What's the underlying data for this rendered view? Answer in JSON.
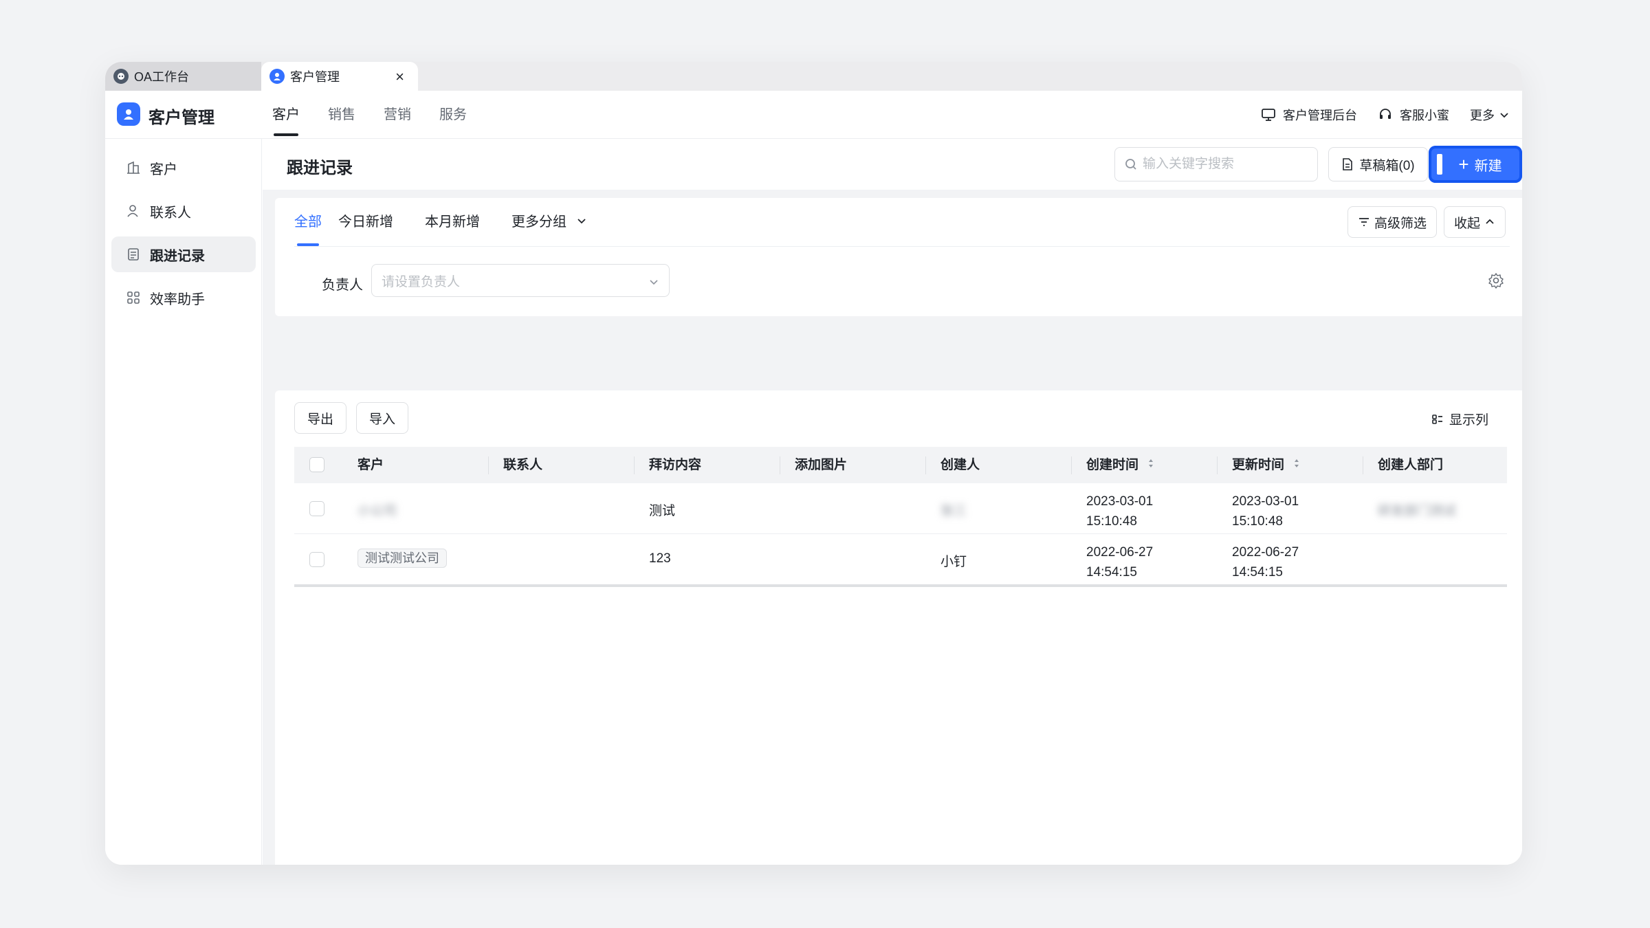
{
  "tabs": [
    {
      "label": "OA工作台"
    },
    {
      "label": "客户管理"
    }
  ],
  "header": {
    "app_title": "客户管理",
    "nav": [
      "客户",
      "销售",
      "营销",
      "服务"
    ],
    "right": {
      "admin": "客户管理后台",
      "assistant": "客服小蜜",
      "more": "更多"
    }
  },
  "sidebar": {
    "items": [
      {
        "label": "客户",
        "icon": "building-icon"
      },
      {
        "label": "联系人",
        "icon": "person-icon"
      },
      {
        "label": "跟进记录",
        "icon": "document-icon"
      },
      {
        "label": "效率助手",
        "icon": "grid-icon"
      }
    ]
  },
  "toolbar": {
    "title": "跟进记录",
    "search_placeholder": "输入关键字搜索",
    "drafts": "草稿箱(0)",
    "new": "新建"
  },
  "filters": {
    "tabs": [
      "全部",
      "今日新增",
      "本月新增",
      "更多分组"
    ],
    "advanced": "高级筛选",
    "collapse": "收起",
    "owner_label": "负责人",
    "owner_placeholder": "请设置负责人"
  },
  "table": {
    "export": "导出",
    "import": "导入",
    "show_columns": "显示列",
    "columns": [
      "客户",
      "联系人",
      "拜访内容",
      "添加图片",
      "创建人",
      "创建时间",
      "更新时间",
      "创建人部门"
    ],
    "rows": [
      {
        "customer": "小公司",
        "contact": "",
        "content": "测试",
        "image": "",
        "creator": "张三",
        "created_date": "2023-03-01",
        "created_time": "15:10:48",
        "updated_date": "2023-03-01",
        "updated_time": "15:10:48",
        "department": "研发部门测试"
      },
      {
        "customer": "测试测试公司",
        "contact": "",
        "content": "123",
        "image": "",
        "creator": "小钉",
        "created_date": "2022-06-27",
        "created_time": "14:54:15",
        "updated_date": "2022-06-27",
        "updated_time": "14:54:15",
        "department": ""
      }
    ]
  },
  "colors": {
    "accent": "#3370ff",
    "text": "#1f2329",
    "muted": "#646a73",
    "border": "#dee0e3",
    "background": "#f2f3f5"
  }
}
